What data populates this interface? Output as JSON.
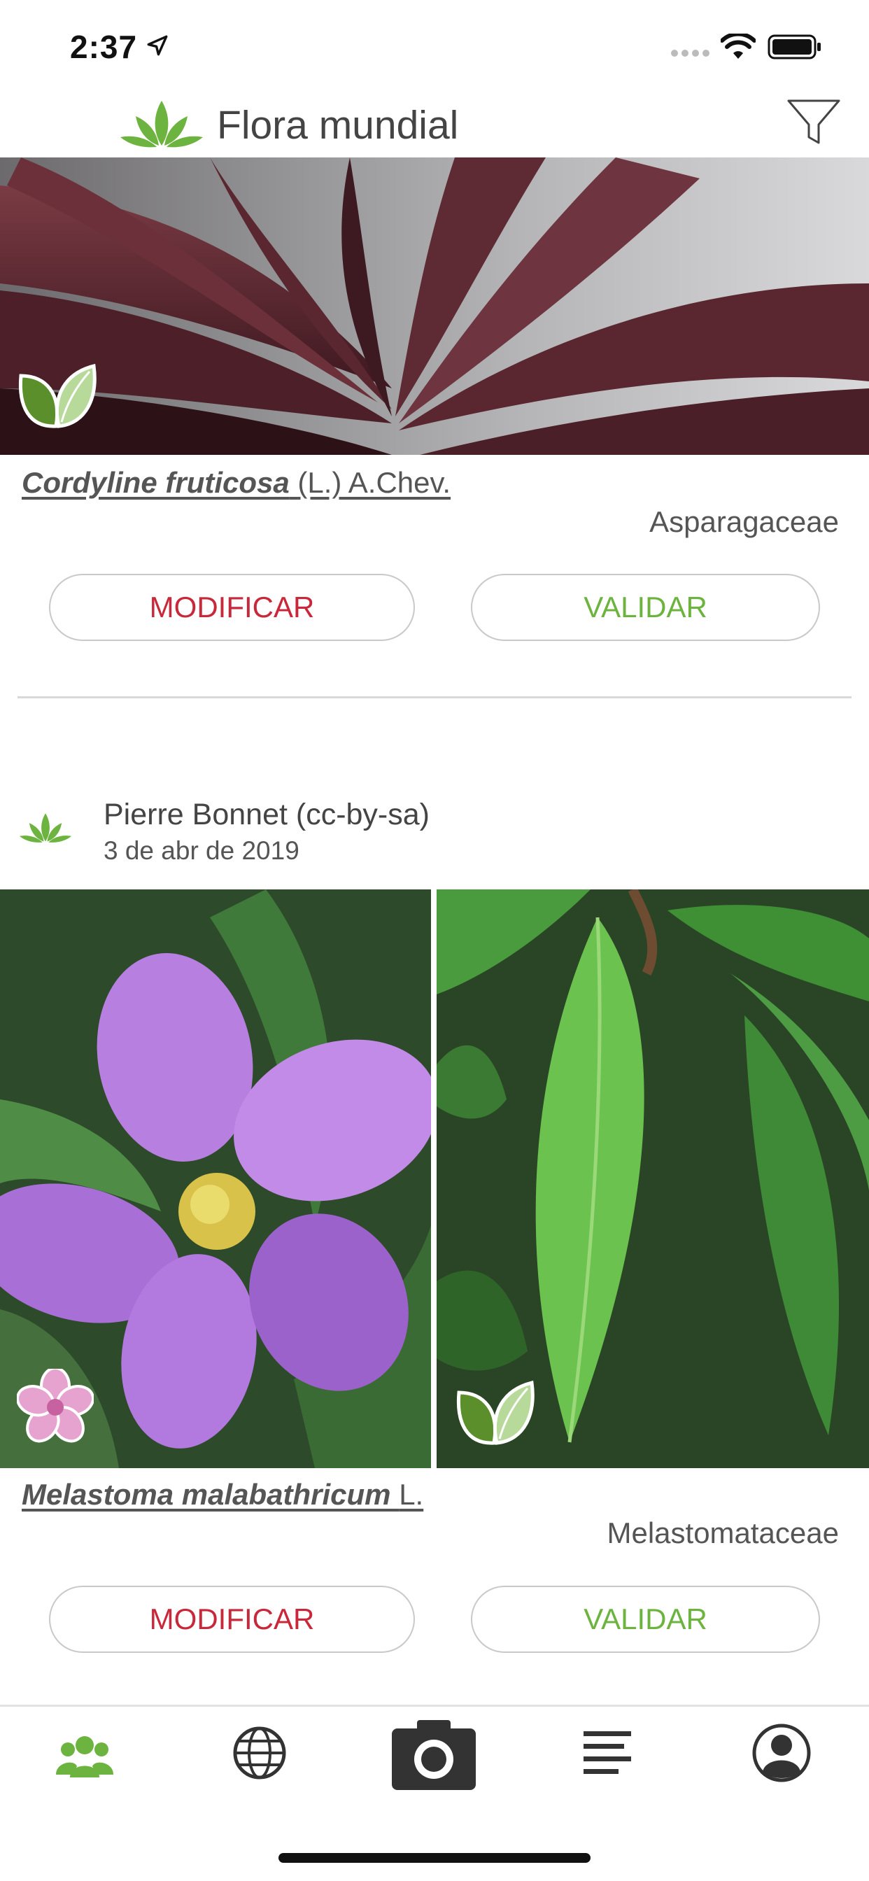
{
  "status_bar": {
    "time": "2:37"
  },
  "header": {
    "title": "Flora mundial"
  },
  "observations": [
    {
      "species_name": "Cordyline fruticosa",
      "species_author": "(L.) A.Chev.",
      "family": "Asparagaceae",
      "modify_label": "MODIFICAR",
      "validate_label": "VALIDAR"
    },
    {
      "author": "Pierre Bonnet (cc-by-sa)",
      "date": "3 de abr de 2019",
      "species_name": "Melastoma malabathricum",
      "species_author": "L.",
      "family": "Melastomataceae",
      "modify_label": "MODIFICAR",
      "validate_label": "VALIDAR"
    }
  ],
  "tabbar": {
    "items": [
      "community-icon",
      "world-icon",
      "camera-icon",
      "list-icon",
      "profile-icon"
    ],
    "active": "community-icon"
  },
  "colors": {
    "brand_green": "#6db33f",
    "modify_red": "#c8283a",
    "text_gray": "#555555"
  }
}
